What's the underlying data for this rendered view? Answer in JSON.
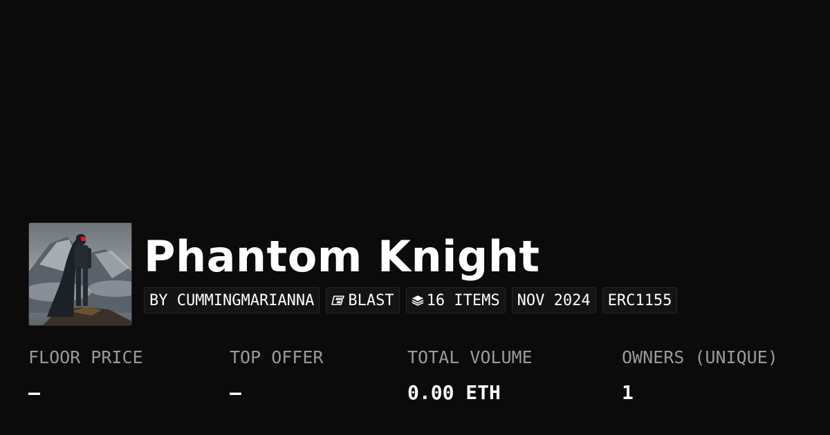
{
  "collection": {
    "title": "Phantom Knight",
    "avatar_alt": "armored knight on a misty mountain"
  },
  "tags": {
    "creator": "BY CUMMINGMARIANNA",
    "chain": "BLAST",
    "chain_icon": "blast-logo-icon",
    "items": "16 ITEMS",
    "items_icon": "layers-icon",
    "date": "NOV 2024",
    "standard": "ERC1155"
  },
  "stats": {
    "floor_price": {
      "label": "FLOOR PRICE",
      "value": "—"
    },
    "top_offer": {
      "label": "TOP OFFER",
      "value": "—"
    },
    "total_volume": {
      "label": "TOTAL VOLUME",
      "value": "0.00 ETH"
    },
    "owners": {
      "label": "OWNERS (UNIQUE)",
      "value": "1"
    }
  },
  "colors": {
    "background": "#0b0b0b",
    "tag_background": "#141414",
    "label": "#9a9a9a",
    "accent_red": "#e0201c"
  }
}
